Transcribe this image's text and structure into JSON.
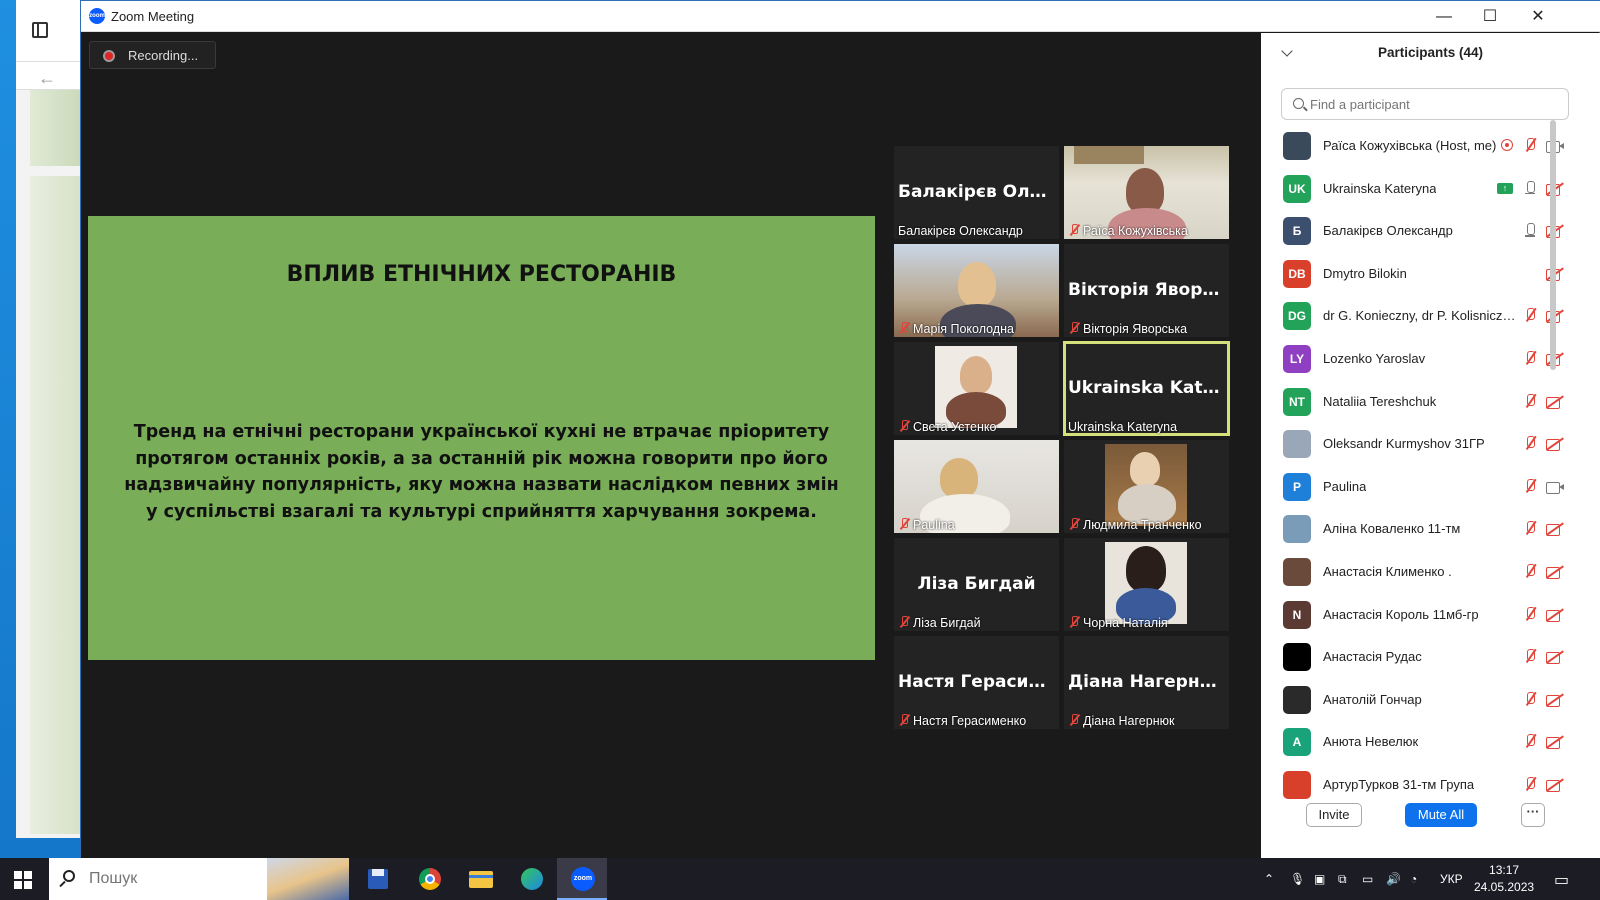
{
  "window": {
    "title": "Zoom Meeting",
    "recording_label": "Recording..."
  },
  "slide": {
    "title": "ВПЛИВ ЕТНІЧНИХ РЕСТОРАНІВ",
    "body_lines": [
      "Тренд на етнічні ресторани української кухні не втрачає пріоритету",
      "протягом останніх років, а за останній рік можна говорити про його",
      "надзвичайну популярність, яку можна назвати наслідком певних змін",
      "у суспільстві взагалі та культурі сприйняття харчування зокрема."
    ]
  },
  "tiles": [
    {
      "big": "Балакірєв Олек...",
      "name": "Балакірєв Олександр",
      "muted": false,
      "photo": false
    },
    {
      "big": "",
      "name": "Раїса Кожухівська",
      "muted": true,
      "photo": true
    },
    {
      "big": "",
      "name": "Марія Поколодна",
      "muted": true,
      "photo": true
    },
    {
      "big": "Вікторія Яворс...",
      "name": "Вікторія Яворська",
      "muted": true,
      "photo": false
    },
    {
      "big": "",
      "name": "Света Устенко",
      "muted": true,
      "photo": true
    },
    {
      "big": "Ukrainska Kater...",
      "name": "Ukrainska Kateryna",
      "muted": false,
      "photo": false
    },
    {
      "big": "",
      "name": "Paulina",
      "muted": true,
      "photo": true
    },
    {
      "big": "",
      "name": "Людмила Транченко",
      "muted": true,
      "photo": true
    },
    {
      "big": "Ліза Бигдай",
      "name": "Ліза Бигдай",
      "muted": true,
      "photo": false
    },
    {
      "big": "",
      "name": "Чорна Наталія",
      "muted": true,
      "photo": true
    },
    {
      "big": "Настя Герасиме...",
      "name": "Настя Герасименко",
      "muted": true,
      "photo": false
    },
    {
      "big": "Діана Нагернюк",
      "name": "Діана Нагернюк",
      "muted": true,
      "photo": false
    }
  ],
  "participants": {
    "title": "Participants (44)",
    "search_placeholder": "Find a participant",
    "items": [
      {
        "initials": "",
        "color": "#3b4a5a",
        "name": "Раїса Кожухівська (Host, me)",
        "mic": "muted",
        "cam": "on",
        "extra": "rec"
      },
      {
        "initials": "UK",
        "color": "#23a35a",
        "name": "Ukrainska Kateryna",
        "mic": "on",
        "cam": "off",
        "extra": "share"
      },
      {
        "initials": "Б",
        "color": "#3d4f6e",
        "name": "Балакірєв Олександр",
        "mic": "on",
        "cam": "off",
        "extra": ""
      },
      {
        "initials": "DB",
        "color": "#d9402b",
        "name": "Dmytro Bilokin",
        "mic": "none",
        "cam": "off",
        "extra": ""
      },
      {
        "initials": "DG",
        "color": "#23a35a",
        "name": "dr G. Konieczny, dr P. Kolisniczen...",
        "mic": "muted",
        "cam": "off",
        "extra": ""
      },
      {
        "initials": "LY",
        "color": "#8e3fc2",
        "name": "Lozenko Yaroslav",
        "mic": "muted",
        "cam": "off",
        "extra": ""
      },
      {
        "initials": "NT",
        "color": "#23a35a",
        "name": "Nataliia Tereshchuk",
        "mic": "muted",
        "cam": "off",
        "extra": ""
      },
      {
        "initials": "",
        "color": "#9aa7b8",
        "name": "Oleksandr Kurmyshov 31ГР",
        "mic": "muted",
        "cam": "off",
        "extra": ""
      },
      {
        "initials": "P",
        "color": "#1e80d9",
        "name": "Paulina",
        "mic": "muted",
        "cam": "on",
        "extra": ""
      },
      {
        "initials": "",
        "color": "#7a9cb8",
        "name": "Аліна Коваленко 11-тм",
        "mic": "muted",
        "cam": "off",
        "extra": ""
      },
      {
        "initials": "",
        "color": "#6a4a3a",
        "name": "Анастасія Клименко .",
        "mic": "muted",
        "cam": "off",
        "extra": ""
      },
      {
        "initials": "N",
        "color": "#5a3a32",
        "name": "Анастасія Король 11мб-гр",
        "mic": "muted",
        "cam": "off",
        "extra": ""
      },
      {
        "initials": "",
        "color": "#000000",
        "name": "Анастасія Рудас",
        "mic": "muted",
        "cam": "off",
        "extra": ""
      },
      {
        "initials": "",
        "color": "#2a2a2a",
        "name": "Анатолій Гончар",
        "mic": "muted",
        "cam": "off",
        "extra": ""
      },
      {
        "initials": "A",
        "color": "#1aa37a",
        "name": "Анюта Невелюк",
        "mic": "muted",
        "cam": "off",
        "extra": ""
      },
      {
        "initials": "",
        "color": "#d9402b",
        "name": "АртурТурков 31-тм Група",
        "mic": "muted",
        "cam": "off",
        "extra": ""
      }
    ],
    "buttons": {
      "invite": "Invite",
      "mute_all": "Mute All",
      "more": "···"
    }
  },
  "taskbar": {
    "search_placeholder": "Пошук",
    "language": "УКР",
    "time": "13:17",
    "date": "24.05.2023"
  }
}
